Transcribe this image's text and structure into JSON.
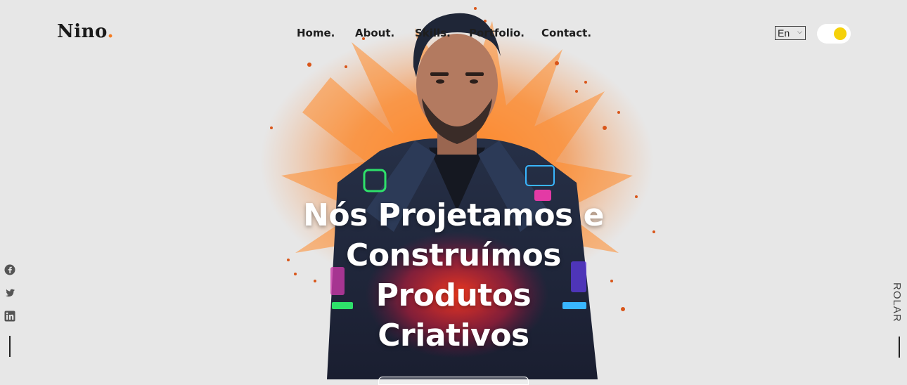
{
  "header": {
    "logo_text": "Nino",
    "logo_dot": ".",
    "nav": [
      "Home.",
      "About.",
      "Skills.",
      "Portfolio.",
      "Contact."
    ],
    "language": {
      "selected": "En"
    },
    "theme_toggle": {
      "state": "on",
      "knob_color": "#f5d10a"
    }
  },
  "hero": {
    "title_lines": [
      "Nós Projetamos e",
      "Construímos",
      "Produtos",
      "Criativos"
    ],
    "image_subject": "man in neon-patched leather jacket with orange paint splash"
  },
  "social": {
    "icons": [
      "facebook-icon",
      "twitter-icon",
      "linkedin-icon"
    ]
  },
  "scroll": {
    "label": "ROLAR"
  },
  "colors": {
    "background": "#e7e7e7",
    "accent": "#f47b20",
    "text": "#1c1c1c",
    "hero_text": "#ffffff"
  }
}
